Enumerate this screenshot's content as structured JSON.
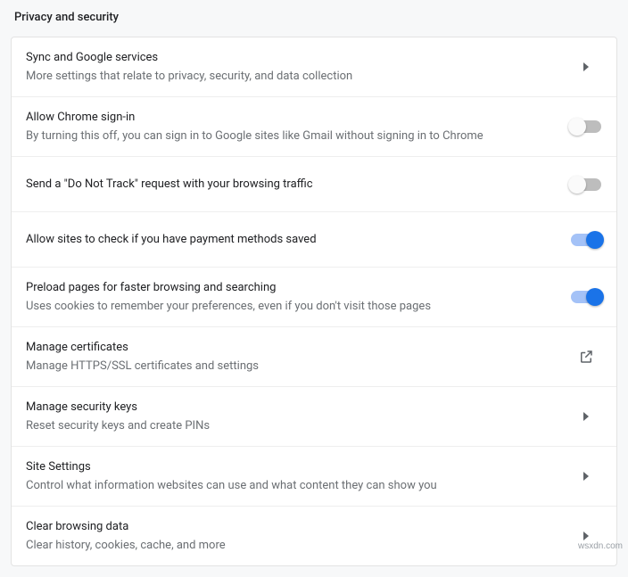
{
  "section_title": "Privacy and security",
  "rows": [
    {
      "title": "Sync and Google services",
      "sub": "More settings that relate to privacy, security, and data collection",
      "action": "chevron"
    },
    {
      "title": "Allow Chrome sign-in",
      "sub": "By turning this off, you can sign in to Google sites like Gmail without signing in to Chrome",
      "action": "toggle",
      "toggle": false
    },
    {
      "title": "Send a \"Do Not Track\" request with your browsing traffic",
      "sub": "",
      "action": "toggle",
      "toggle": false
    },
    {
      "title": "Allow sites to check if you have payment methods saved",
      "sub": "",
      "action": "toggle",
      "toggle": true
    },
    {
      "title": "Preload pages for faster browsing and searching",
      "sub": "Uses cookies to remember your preferences, even if you don't visit those pages",
      "action": "toggle",
      "toggle": true
    },
    {
      "title": "Manage certificates",
      "sub": "Manage HTTPS/SSL certificates and settings",
      "action": "external"
    },
    {
      "title": "Manage security keys",
      "sub": "Reset security keys and create PINs",
      "action": "chevron"
    },
    {
      "title": "Site Settings",
      "sub": "Control what information websites can use and what content they can show you",
      "action": "chevron"
    },
    {
      "title": "Clear browsing data",
      "sub": "Clear history, cookies, cache, and more",
      "action": "chevron"
    }
  ],
  "watermark": "wsxdn.com"
}
